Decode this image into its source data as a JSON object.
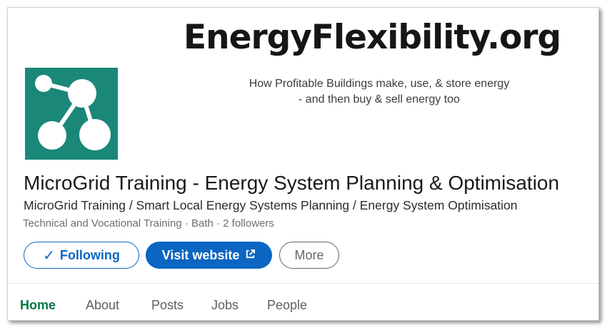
{
  "banner": {
    "title": "EnergyFlexibility.org",
    "tagline_line1": "How Profitable Buildings make, use, & store energy",
    "tagline_line2": "- and then buy & sell energy too"
  },
  "organization": {
    "name": "MicroGrid Training - Energy System Planning & Optimisation",
    "tagline": "MicroGrid Training / Smart Local Energy Systems Planning / Energy System Optimisation",
    "meta": "Technical and Vocational Training · Bath · 2 followers"
  },
  "actions": {
    "following_check": "✓",
    "following_label": "Following",
    "visit_label": "Visit website",
    "more_label": "More"
  },
  "tabs": [
    {
      "label": "Home",
      "active": true
    },
    {
      "label": "About"
    },
    {
      "label": "Posts"
    },
    {
      "label": "Jobs"
    },
    {
      "label": "People"
    }
  ],
  "colors": {
    "accent": "#0a66c2",
    "active_tab": "#057642",
    "logo_bg": "#1a8779"
  },
  "icons": {
    "logo": "network-nodes-icon",
    "external_link": "external-link-icon",
    "check": "check-icon"
  }
}
